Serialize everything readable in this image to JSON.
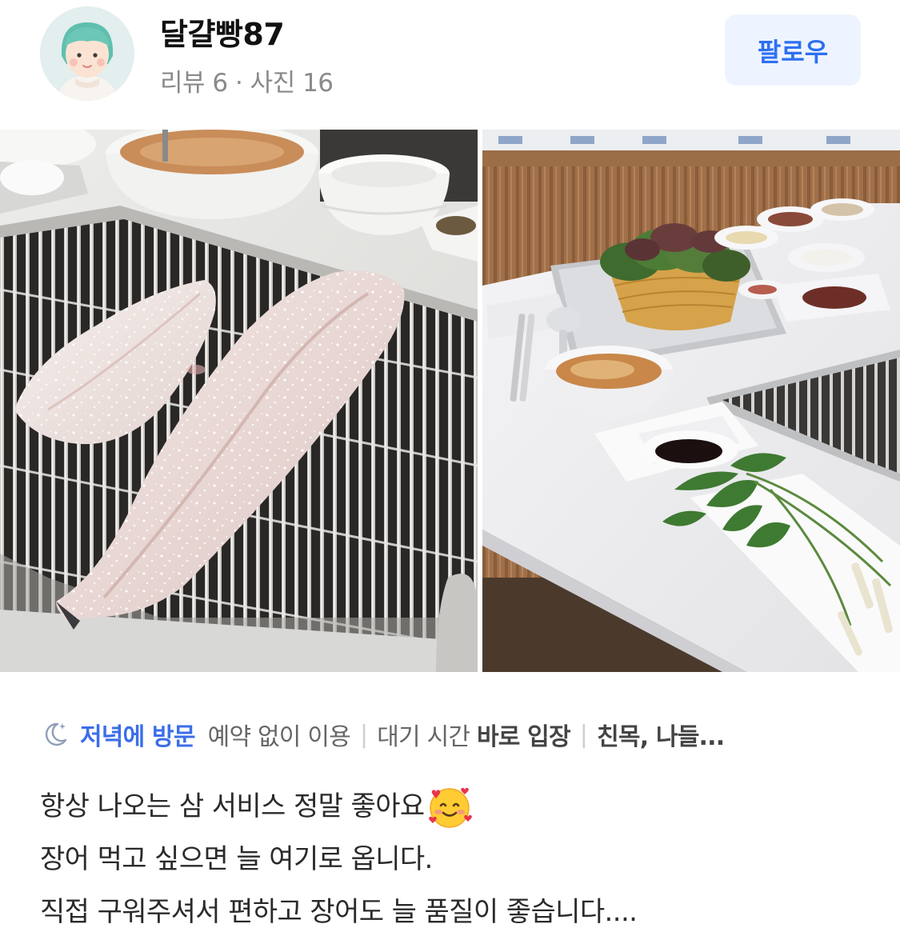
{
  "profile": {
    "username": "달걀빵87",
    "stats": "리뷰 6 · 사진 16",
    "follow_label": "팔로우",
    "avatar_icon": "user-avatar-icon"
  },
  "photos": [
    {
      "subject": "grilled-eel-on-grill-photo"
    },
    {
      "subject": "table-side-dishes-photo"
    }
  ],
  "visit": {
    "time_icon": "moon-icon",
    "time_label": "저녁에 방문",
    "reservation_label": "예약 없이 이용",
    "wait_label": "대기 시간",
    "wait_value": "바로 입장",
    "purpose": "친목, 나들..."
  },
  "review": {
    "line1": "항상 나오는 삼 서비스 정말 좋아요",
    "line1_emoji": "smiling-face-with-hearts-icon",
    "line2": "장어 먹고 싶으면 늘 여기로 옵니다.",
    "line3": "직접 구워주셔서 편하고 장어도 늘 품질이 좋습니다...."
  },
  "colors": {
    "accent": "#2d6ff2",
    "follow_bg": "#eef4ff",
    "visit_time": "#3b6ee8",
    "muted": "#8a8a8a"
  }
}
